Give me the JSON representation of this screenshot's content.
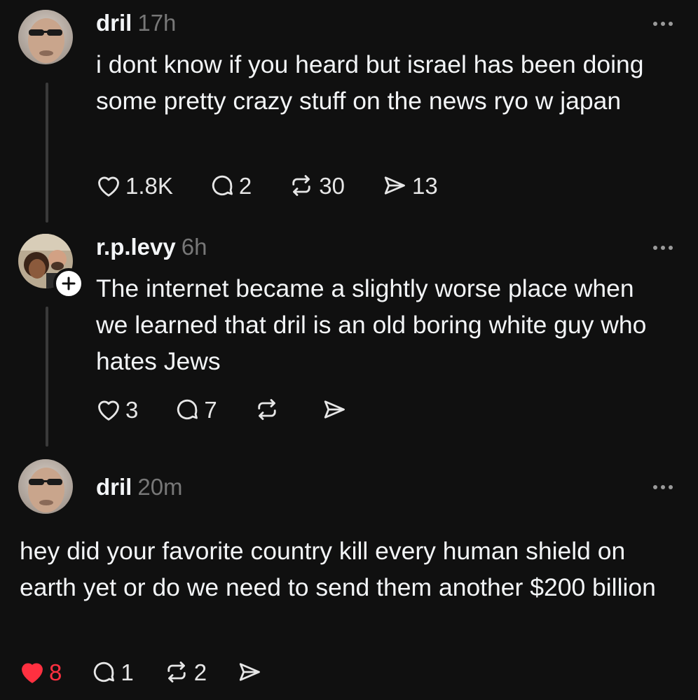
{
  "posts": [
    {
      "username": "dril",
      "time": "17h",
      "text": "i dont know if you heard but israel has been doing some pretty crazy stuff on the news ryo w japan",
      "likes": "1.8K",
      "replies": "2",
      "reposts": "30",
      "shares": "13"
    },
    {
      "username": "r.p.levy",
      "time": "6h",
      "text": "The internet became a slightly worse place when we learned that dril is an old boring white guy who hates Jews",
      "likes": "3",
      "replies": "7",
      "reposts": "",
      "shares": ""
    },
    {
      "username": "dril",
      "time": "20m",
      "text": "hey did your favorite country kill every human shield on earth yet or do we need to send them another $200 billion",
      "likes": "8",
      "liked": true,
      "replies": "1",
      "reposts": "2",
      "shares": ""
    }
  ],
  "colors": {
    "background": "#101010",
    "text": "#f3f5f7",
    "muted": "#777777",
    "liked": "#ff3040",
    "thread_line": "#3a3a3a"
  },
  "icons": [
    "heart-icon",
    "reply-icon",
    "repost-icon",
    "share-icon",
    "more-icon",
    "follow-plus-icon"
  ]
}
